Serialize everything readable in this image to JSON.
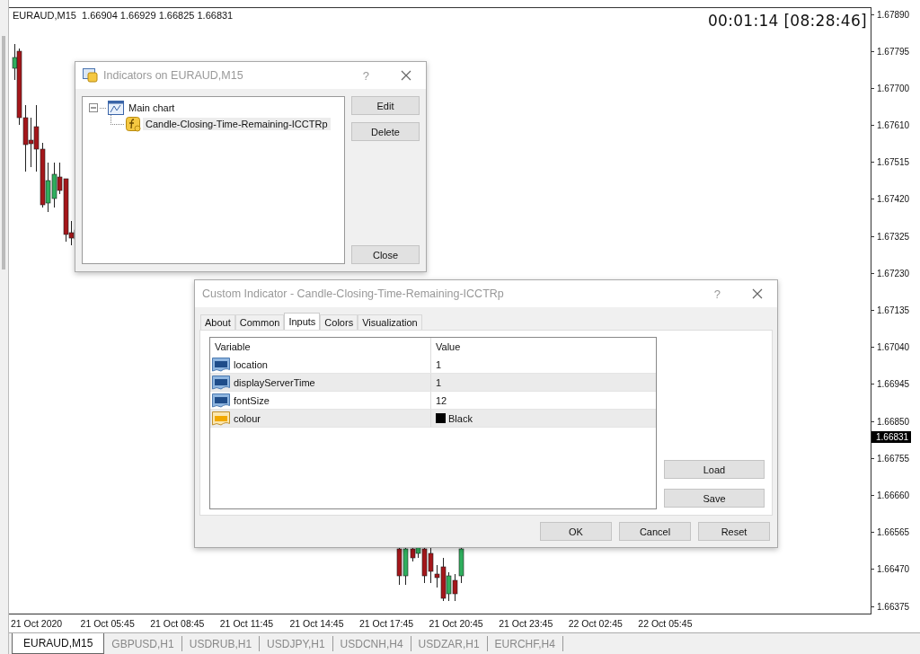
{
  "chart": {
    "symbol_info": "EURAUD,M15  1.66904 1.66929 1.66825 1.66831",
    "timer": "00:01:14 [08:28:46]",
    "price_axis": [
      "1.67890",
      "1.67795",
      "1.67700",
      "1.67610",
      "1.67515",
      "1.67420",
      "1.67325",
      "1.67230",
      "1.67135",
      "1.67040",
      "1.66945",
      "1.66850",
      "1.66755",
      "1.66660",
      "1.66565",
      "1.66470",
      "1.66375"
    ],
    "current_price": "1.66831",
    "time_axis": [
      "21 Oct 2020",
      "21 Oct 05:45",
      "21 Oct 08:45",
      "21 Oct 11:45",
      "21 Oct 14:45",
      "21 Oct 17:45",
      "21 Oct 20:45",
      "21 Oct 23:45",
      "22 Oct 02:45",
      "22 Oct 05:45"
    ]
  },
  "indicators_dialog": {
    "title": "Indicators on EURAUD,M15",
    "help": "?",
    "tree": [
      {
        "label": "Main chart",
        "expanded": true,
        "children": [
          {
            "label": "Candle-Closing-Time-Remaining-ICCTRp",
            "selected": true
          }
        ]
      }
    ],
    "buttons": [
      "Edit",
      "Delete",
      "Close"
    ]
  },
  "custom_indicator_dialog": {
    "title": "Custom Indicator - Candle-Closing-Time-Remaining-ICCTRp",
    "help": "?",
    "tabs": [
      {
        "label": "About",
        "selected": false
      },
      {
        "label": "Common",
        "selected": false
      },
      {
        "label": "Inputs",
        "selected": true
      },
      {
        "label": "Colors",
        "selected": false
      },
      {
        "label": "Visualization",
        "selected": false
      }
    ],
    "table": {
      "columns": [
        "Variable",
        "Value"
      ],
      "rows": [
        {
          "kind": "number",
          "variable": "location",
          "value": "1"
        },
        {
          "kind": "number",
          "variable": "displayServerTime",
          "value": "1"
        },
        {
          "kind": "number",
          "variable": "fontSize",
          "value": "12"
        },
        {
          "kind": "color",
          "variable": "colour",
          "value": "Black",
          "color": "#000000"
        }
      ]
    },
    "side_buttons": [
      "Load",
      "Save"
    ],
    "buttons": [
      "OK",
      "Cancel",
      "Reset"
    ]
  },
  "symbol_tabs": [
    {
      "label": "EURAUD,M15",
      "selected": true
    },
    {
      "label": "GBPUSD,H1",
      "selected": false
    },
    {
      "label": "USDRUB,H1",
      "selected": false
    },
    {
      "label": "USDJPY,H1",
      "selected": false
    },
    {
      "label": "USDCNH,H4",
      "selected": false
    },
    {
      "label": "USDZAR,H1",
      "selected": false
    },
    {
      "label": "EURCHF,H4",
      "selected": false
    }
  ]
}
